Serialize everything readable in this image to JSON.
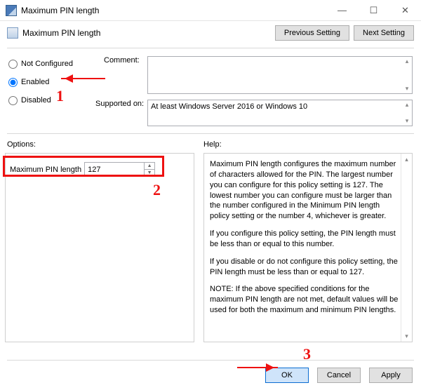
{
  "window": {
    "title": "Maximum PIN length",
    "minimize_glyph": "—",
    "maximize_glyph": "☐",
    "close_glyph": "✕"
  },
  "header": {
    "policy_name": "Maximum PIN length",
    "previous_setting": "Previous Setting",
    "next_setting": "Next Setting"
  },
  "radios": {
    "not_configured": "Not Configured",
    "enabled": "Enabled",
    "disabled": "Disabled",
    "selected": "enabled"
  },
  "comment": {
    "label": "Comment:",
    "value": ""
  },
  "supported": {
    "label": "Supported on:",
    "value": "At least Windows Server 2016 or Windows 10"
  },
  "options": {
    "section_label": "Options:",
    "pin_label": "Maximum PIN length",
    "pin_value": "127"
  },
  "help": {
    "section_label": "Help:",
    "p1": "Maximum PIN length configures the maximum number of characters allowed for the PIN.  The largest number you can configure for this policy setting is 127. The lowest number you can configure must be larger than the number configured in the Minimum PIN length policy setting or the number 4, whichever is greater.",
    "p2": "If you configure this policy setting, the PIN length must be less than or equal to this number.",
    "p3": "If you disable or do not configure this policy setting, the PIN length must be less than or equal to 127.",
    "p4": "NOTE: If the above specified conditions for the maximum PIN length are not met, default values will be used for both the maximum and minimum PIN lengths."
  },
  "buttons": {
    "ok": "OK",
    "cancel": "Cancel",
    "apply": "Apply"
  },
  "annotations": {
    "num1": "1",
    "num2": "2",
    "num3": "3"
  }
}
